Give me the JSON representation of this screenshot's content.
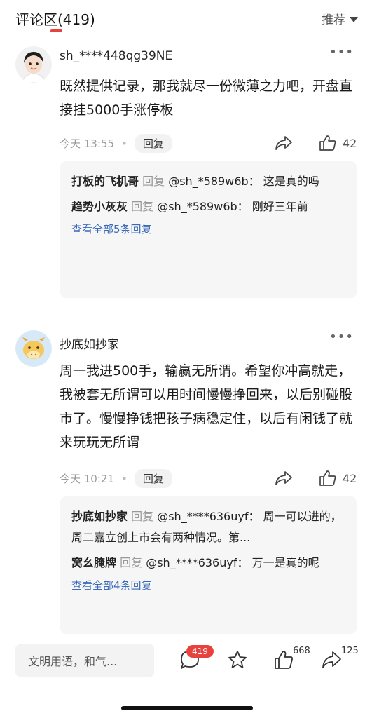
{
  "header": {
    "title": "评论区(419)",
    "sort_label": "推荐",
    "accent": "#e8423f"
  },
  "comments": [
    {
      "username": "sh_****448qg39NE",
      "content": "既然提供记录，那我就尽一份微薄之力吧，开盘直接挂5000手涨停板",
      "time": "今天 13:55",
      "reply_label": "回复",
      "likes": "42",
      "replies": [
        {
          "author": "打板的飞机哥",
          "reply_word": "回复",
          "target": "@sh_*589w6b：",
          "text": "这是真的吗"
        },
        {
          "author": "趋势小灰灰",
          "reply_word": "回复",
          "target": "@sh_*589w6b：",
          "text": "刚好三年前"
        }
      ],
      "view_all": "查看全部5条回复"
    },
    {
      "username": "抄底如抄家",
      "content": "周一我进500手，输赢无所谓。希望你冲高就走，我被套无所谓可以用时间慢慢挣回来，以后别碰股市了。慢慢挣钱把孩子病稳定住，以后有闲钱了就来玩玩无所谓",
      "time": "今天 10:21",
      "reply_label": "回复",
      "likes": "42",
      "replies": [
        {
          "author": "抄底如抄家",
          "reply_word": "回复",
          "target": "@sh_****636uyf：",
          "text": "周一可以进的，周二嘉立创上市会有两种情况。第..."
        },
        {
          "author": "窝幺腌牌",
          "reply_word": "回复",
          "target": "@sh_****636uyf：",
          "text": "万一是真的呢"
        }
      ],
      "view_all": "查看全部4条回复"
    }
  ],
  "bottom_bar": {
    "input_placeholder": "文明用语，和气...",
    "comment_badge": "419",
    "like_count": "668",
    "share_count": "125"
  }
}
